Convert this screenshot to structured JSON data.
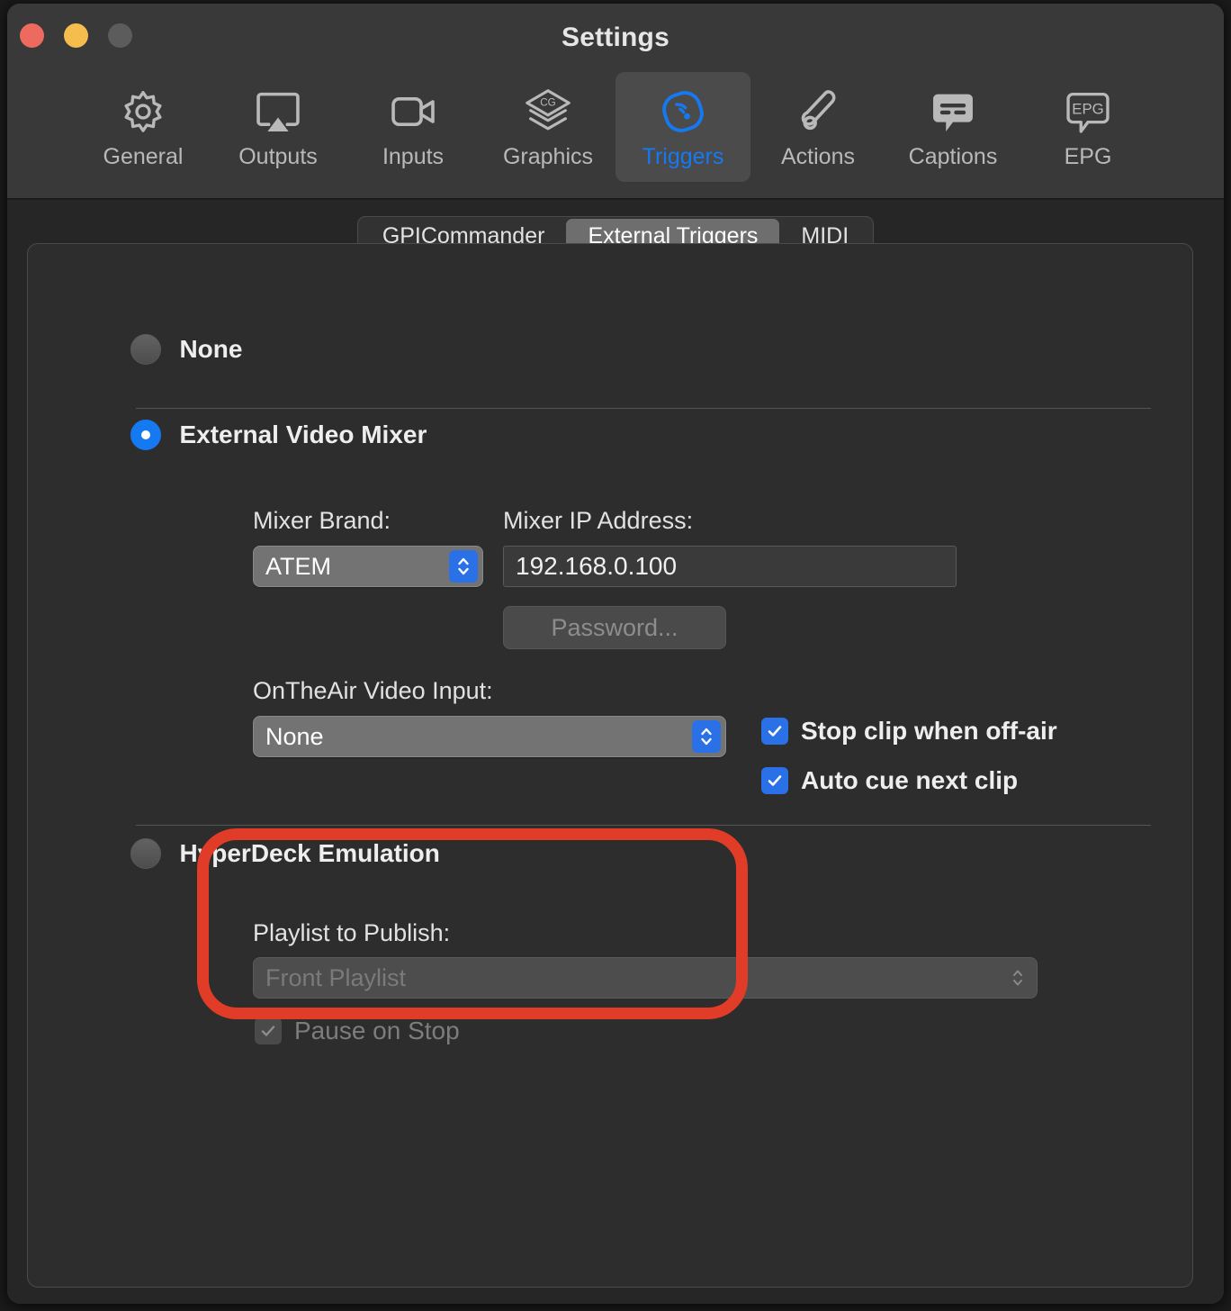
{
  "window": {
    "title": "Settings",
    "traffic_lights": [
      {
        "name": "close",
        "color": "#ED6A5E"
      },
      {
        "name": "minimize",
        "color": "#F4BD4E"
      },
      {
        "name": "zoom",
        "color": "#5C5C5C"
      }
    ]
  },
  "toolbar": {
    "items": [
      {
        "label": "General",
        "icon": "gear-icon",
        "active": false
      },
      {
        "label": "Outputs",
        "icon": "airplay-icon",
        "active": false
      },
      {
        "label": "Inputs",
        "icon": "video-camera-icon",
        "active": false
      },
      {
        "label": "Graphics",
        "icon": "cg-layers-icon",
        "active": false
      },
      {
        "label": "Triggers",
        "icon": "trigger-wifi-icon",
        "active": true
      },
      {
        "label": "Actions",
        "icon": "actions-icon",
        "active": false
      },
      {
        "label": "Captions",
        "icon": "caption-bubble-icon",
        "active": false
      },
      {
        "label": "EPG",
        "icon": "epg-bubble-icon",
        "active": false
      }
    ],
    "accent_color": "#1579f2"
  },
  "tabs": [
    {
      "label": "GPICommander",
      "active": false
    },
    {
      "label": "External Triggers",
      "active": true
    },
    {
      "label": "MIDI",
      "active": false
    }
  ],
  "main": {
    "mode_options": [
      {
        "label": "None",
        "selected": false
      },
      {
        "label": "External Video Mixer",
        "selected": true
      },
      {
        "label": "HyperDeck Emulation",
        "selected": false
      }
    ],
    "mixer_brand": {
      "label": "Mixer Brand:",
      "value": "ATEM"
    },
    "mixer_ip": {
      "label": "Mixer IP Address:",
      "value": "192.168.0.100"
    },
    "password_button": {
      "label": "Password...",
      "enabled": false
    },
    "ontheair_video_input": {
      "label": "OnTheAir Video Input:",
      "value": "None"
    },
    "mixer_checkboxes": [
      {
        "label": "Stop clip when off-air",
        "checked": true,
        "enabled": true
      },
      {
        "label": "Auto cue next clip",
        "checked": true,
        "enabled": true
      }
    ],
    "hyperdeck": {
      "playlist_label": "Playlist to Publish:",
      "playlist_value": "Front Playlist",
      "pause_on_stop": {
        "label": "Pause on Stop",
        "checked": true,
        "enabled": false
      }
    }
  },
  "annotation": {
    "color": "#E03C27",
    "targets": "ontheair-video-input"
  }
}
